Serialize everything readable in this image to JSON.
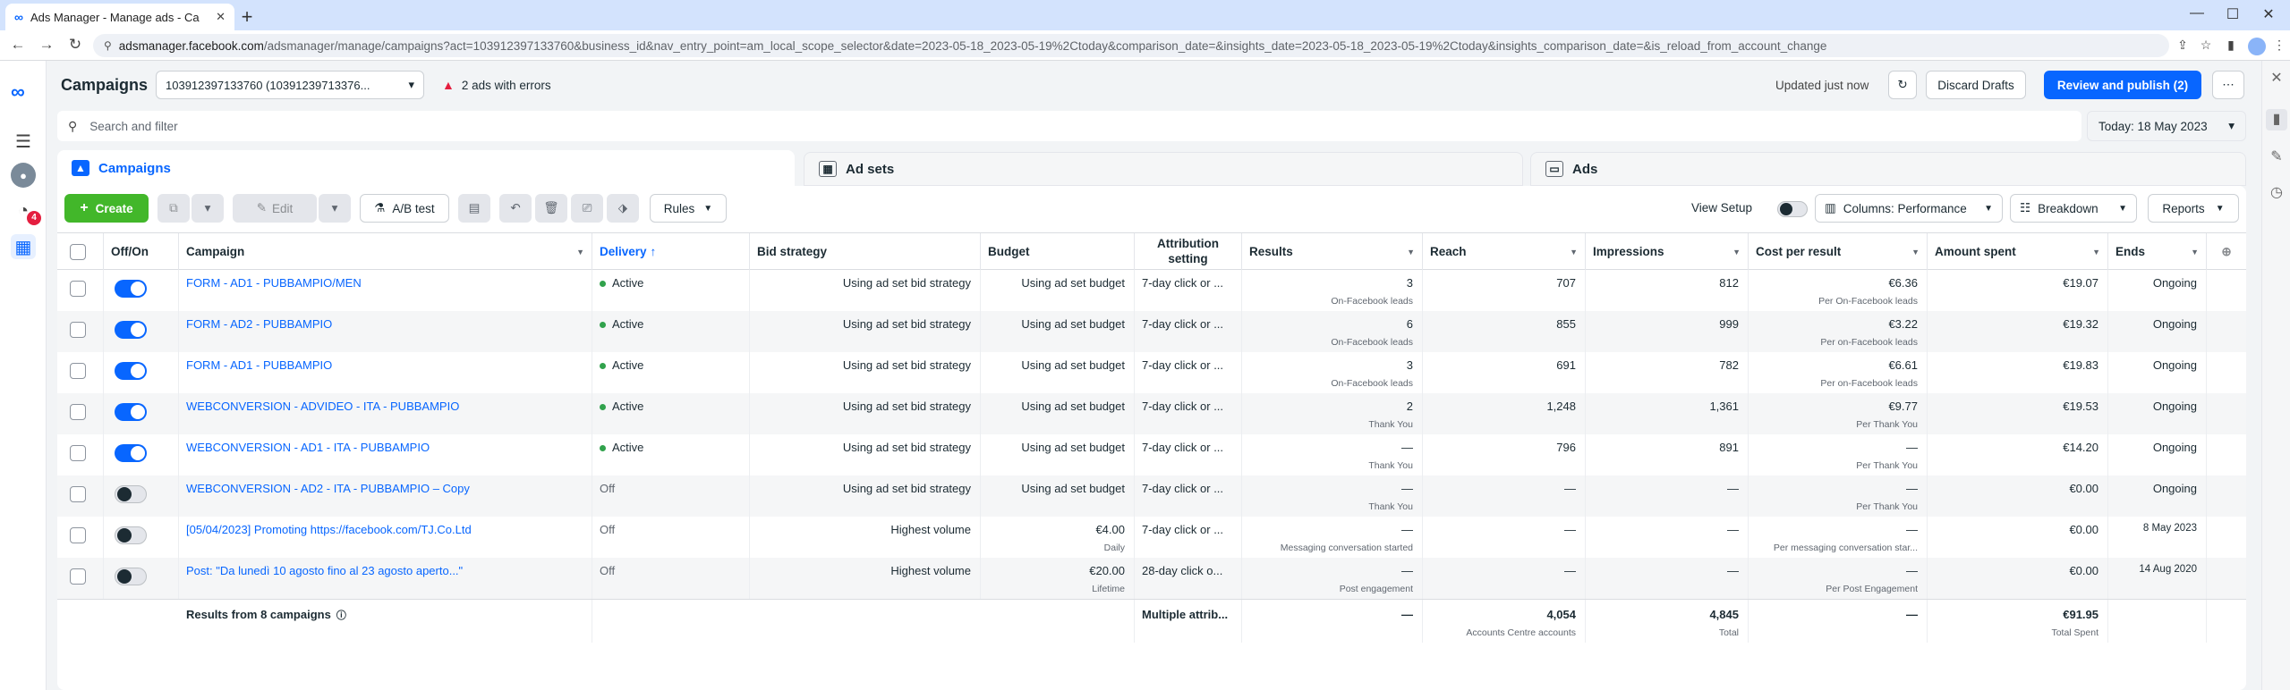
{
  "browser": {
    "tab_title": "Ads Manager - Manage ads - Ca",
    "url_host": "adsmanager.facebook.com",
    "url_path": "/adsmanager/manage/campaigns?act=103912397133760&business_id&nav_entry_point=am_local_scope_selector&date=2023-05-18_2023-05-19%2Ctoday&comparison_date=&insights_date=2023-05-18_2023-05-19%2Ctoday&insights_comparison_date=&is_reload_from_account_change"
  },
  "rail": {
    "notif_count": "4"
  },
  "header": {
    "title": "Campaigns",
    "account": "103912397133760 (10391239713376...",
    "errors": "2 ads with errors",
    "updated": "Updated just now",
    "discard": "Discard Drafts",
    "review": "Review and publish (2)"
  },
  "search": {
    "placeholder": "Search and filter",
    "date": "Today: 18 May 2023"
  },
  "tabs": {
    "campaigns": "Campaigns",
    "adsets": "Ad sets",
    "ads": "Ads"
  },
  "toolbar": {
    "create": "Create",
    "edit": "Edit",
    "ab_test": "A/B test",
    "rules": "Rules",
    "view_setup": "View Setup",
    "columns": "Columns: Performance",
    "breakdown": "Breakdown",
    "reports": "Reports"
  },
  "columns": {
    "offon": "Off/On",
    "campaign": "Campaign",
    "delivery": "Delivery",
    "bid": "Bid strategy",
    "budget": "Budget",
    "attribution": "Attribution setting",
    "results": "Results",
    "reach": "Reach",
    "impressions": "Impressions",
    "cpr": "Cost per result",
    "spent": "Amount spent",
    "ends": "Ends"
  },
  "rows": [
    {
      "on": true,
      "name": "FORM - AD1 - PUBBAMPIO/MEN",
      "delivery": "Active",
      "bid": "Using ad set bid strategy",
      "budget": "Using ad set budget",
      "budget_sub": "",
      "attr": "7-day click or ...",
      "results": "3",
      "results_sub": "On-Facebook leads",
      "reach": "707",
      "impr": "812",
      "cpr": "€6.36",
      "cpr_sub": "Per On-Facebook leads",
      "spent": "€19.07",
      "ends": "Ongoing"
    },
    {
      "on": true,
      "name": "FORM - AD2 - PUBBAMPIO",
      "delivery": "Active",
      "bid": "Using ad set bid strategy",
      "budget": "Using ad set budget",
      "budget_sub": "",
      "attr": "7-day click or ...",
      "results": "6",
      "results_sub": "On-Facebook leads",
      "reach": "855",
      "impr": "999",
      "cpr": "€3.22",
      "cpr_sub": "Per on-Facebook leads",
      "spent": "€19.32",
      "ends": "Ongoing"
    },
    {
      "on": true,
      "name": "FORM - AD1 - PUBBAMPIO",
      "delivery": "Active",
      "bid": "Using ad set bid strategy",
      "budget": "Using ad set budget",
      "budget_sub": "",
      "attr": "7-day click or ...",
      "results": "3",
      "results_sub": "On-Facebook leads",
      "reach": "691",
      "impr": "782",
      "cpr": "€6.61",
      "cpr_sub": "Per on-Facebook leads",
      "spent": "€19.83",
      "ends": "Ongoing"
    },
    {
      "on": true,
      "name": "WEBCONVERSION - ADVIDEO - ITA - PUBBAMPIO",
      "delivery": "Active",
      "bid": "Using ad set bid strategy",
      "budget": "Using ad set budget",
      "budget_sub": "",
      "attr": "7-day click or ...",
      "results": "2",
      "results_sub": "Thank You",
      "reach": "1,248",
      "impr": "1,361",
      "cpr": "€9.77",
      "cpr_sub": "Per Thank You",
      "spent": "€19.53",
      "ends": "Ongoing"
    },
    {
      "on": true,
      "name": "WEBCONVERSION - AD1 - ITA - PUBBAMPIO",
      "delivery": "Active",
      "bid": "Using ad set bid strategy",
      "budget": "Using ad set budget",
      "budget_sub": "",
      "attr": "7-day click or ...",
      "results": "—",
      "results_sub": "Thank You",
      "reach": "796",
      "impr": "891",
      "cpr": "—",
      "cpr_sub": "Per Thank You",
      "spent": "€14.20",
      "ends": "Ongoing"
    },
    {
      "on": false,
      "name": "WEBCONVERSION - AD2 - ITA - PUBBAMPIO – Copy",
      "delivery": "Off",
      "bid": "Using ad set bid strategy",
      "budget": "Using ad set budget",
      "budget_sub": "",
      "attr": "7-day click or ...",
      "results": "—",
      "results_sub": "Thank You",
      "reach": "—",
      "impr": "—",
      "cpr": "—",
      "cpr_sub": "Per Thank You",
      "spent": "€0.00",
      "ends": "Ongoing"
    },
    {
      "on": false,
      "name": "[05/04/2023] Promoting https://facebook.com/TJ.Co.Ltd",
      "delivery": "Off",
      "bid": "Highest volume",
      "budget": "€4.00",
      "budget_sub": "Daily",
      "attr": "7-day click or ...",
      "results": "—",
      "results_sub": "Messaging conversation started",
      "reach": "—",
      "impr": "—",
      "cpr": "—",
      "cpr_sub": "Per messaging conversation star...",
      "spent": "€0.00",
      "ends": "8 May 2023"
    },
    {
      "on": false,
      "name": "Post: \"Da lunedì 10 agosto fino al 23 agosto aperto...\"",
      "delivery": "Off",
      "bid": "Highest volume",
      "budget": "€20.00",
      "budget_sub": "Lifetime",
      "attr": "28-day click o...",
      "results": "—",
      "results_sub": "Post engagement",
      "reach": "—",
      "impr": "—",
      "cpr": "—",
      "cpr_sub": "Per Post Engagement",
      "spent": "€0.00",
      "ends": "14 Aug 2020"
    }
  ],
  "totals": {
    "label": "Results from 8 campaigns",
    "attr": "Multiple attrib...",
    "results": "—",
    "reach": "4,054",
    "reach_sub": "Accounts Centre accounts",
    "impr": "4,845",
    "impr_sub": "Total",
    "cpr": "—",
    "spent": "€91.95",
    "spent_sub": "Total Spent"
  },
  "colors": {
    "accent": "#0866ff",
    "create": "#42b72a",
    "error": "#e41e3f",
    "active": "#31a24c"
  }
}
